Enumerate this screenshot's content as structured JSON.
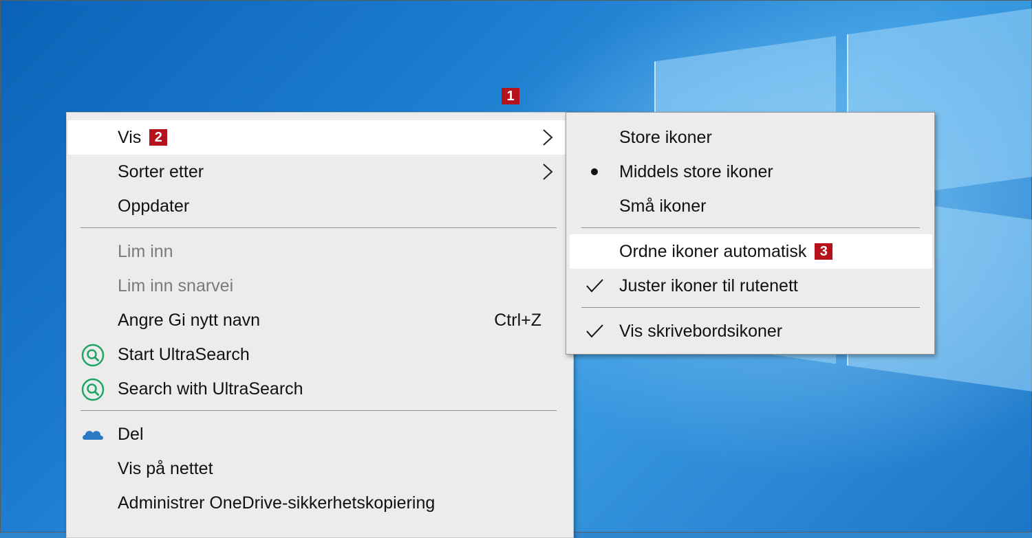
{
  "markers": {
    "m1": "1",
    "m2": "2",
    "m3": "3"
  },
  "main_menu": {
    "items": [
      {
        "label": "Vis"
      },
      {
        "label": "Sorter etter"
      },
      {
        "label": "Oppdater"
      },
      {
        "label": "Lim inn"
      },
      {
        "label": "Lim inn snarvei"
      },
      {
        "label": "Angre Gi nytt navn",
        "shortcut": "Ctrl+Z"
      },
      {
        "label": "Start UltraSearch",
        "icon": "ultrasearch-icon"
      },
      {
        "label": "Search with UltraSearch",
        "icon": "ultrasearch-icon"
      },
      {
        "label": "Del",
        "icon": "onedrive-cloud-icon"
      },
      {
        "label": "Vis på nettet"
      },
      {
        "label": "Administrer OneDrive-sikkerhetskopiering"
      }
    ]
  },
  "sub_menu": {
    "items": [
      {
        "label": "Store ikoner"
      },
      {
        "label": "Middels store ikoner",
        "state": "bullet-icon"
      },
      {
        "label": "Små ikoner"
      },
      {
        "label": "Ordne ikoner automatisk"
      },
      {
        "label": "Juster ikoner til rutenett",
        "state": "checkmark-icon"
      },
      {
        "label": "Vis skrivebordsikoner",
        "state": "checkmark-icon"
      }
    ]
  },
  "colors": {
    "marker": "#b5121b",
    "menu_bg": "#ececec",
    "highlight": "#ffffff",
    "disabled_text": "#7a7a7a",
    "ultrasearch": "#1fa463",
    "onedrive": "#2b78c4"
  }
}
